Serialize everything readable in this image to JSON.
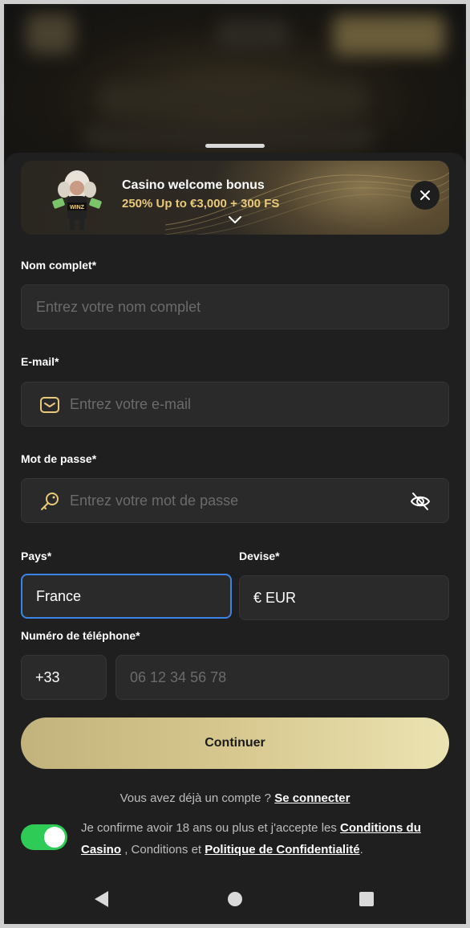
{
  "banner": {
    "title": "Casino welcome bonus",
    "subtitle": "250% Up to €3,000 + 300 FS",
    "mascot_text": "WINZ"
  },
  "form": {
    "full_name": {
      "label": "Nom complet*",
      "placeholder": "Entrez votre nom complet"
    },
    "email": {
      "label": "E-mail*",
      "placeholder": "Entrez votre e-mail"
    },
    "password": {
      "label": "Mot de passe*",
      "placeholder": "Entrez votre mot de passe"
    },
    "country": {
      "label": "Pays*",
      "value": "France"
    },
    "currency": {
      "label": "Devise*",
      "value": "€ EUR"
    },
    "phone": {
      "label": "Numéro de téléphone*",
      "code": "+33",
      "placeholder": "06 12 34 56 78"
    },
    "continue_label": "Continuer"
  },
  "footer": {
    "have_account": "Vous avez déjà un compte ?",
    "login_link": "Se connecter",
    "consent_prefix": "Je confirme avoir 18 ans ou plus et j'accepte les",
    "terms_link": "Conditions du Casino",
    "consent_middle": ", Conditions et",
    "privacy_link": "Politique de Confidentialité",
    "consent_suffix": "."
  },
  "colors": {
    "accent_gold": "#d7c88f",
    "toggle_on": "#2ecc56",
    "focus_border": "#3a84e8",
    "bonus_text": "#e9c97a"
  },
  "icons": {
    "email": "envelope-icon",
    "password": "key-icon",
    "toggle_visibility": "eye-off-icon",
    "close": "close-icon",
    "expand": "chevron-down-icon"
  }
}
